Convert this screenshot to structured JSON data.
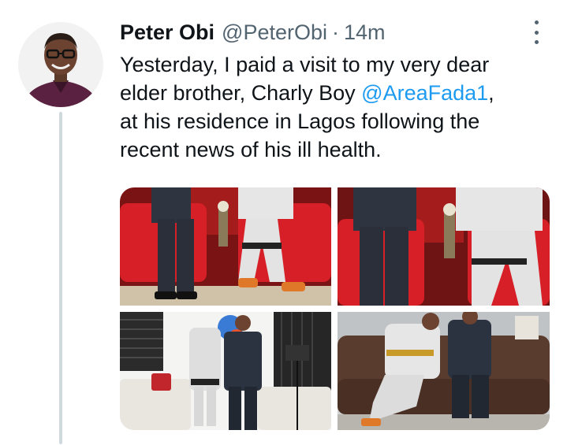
{
  "author": {
    "name": "Peter Obi",
    "handle": "@PeterObi",
    "separator": "·",
    "time": "14m"
  },
  "more_icon": "more-vertical-icon",
  "tweet": {
    "line1": "Yesterday, I paid a visit to my very dear",
    "line2_prefix": "elder brother, Charly Boy ",
    "line2_mention": "@AreaFada1",
    "line2_suffix": ",",
    "line3": "at his residence in Lagos following the",
    "line4": "recent news of his ill health."
  },
  "colors": {
    "mention": "#1d9bf0",
    "secondary_text": "#536471",
    "thread_line": "#cfd9de"
  },
  "media": {
    "photo_count": 4
  }
}
